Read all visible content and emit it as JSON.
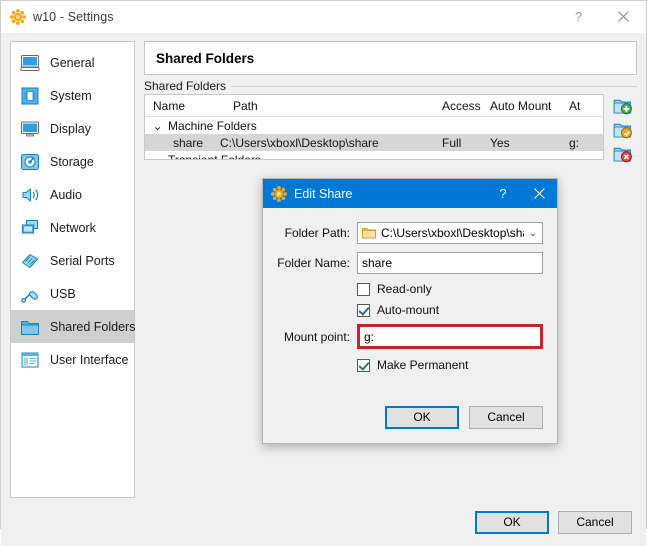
{
  "window": {
    "title": "w10 - Settings",
    "icon": "virtualbox-icon",
    "help_label": "?",
    "close_label": "✕"
  },
  "sidebar": {
    "items": [
      {
        "label": "General",
        "icon": "general-icon",
        "selected": false
      },
      {
        "label": "System",
        "icon": "system-icon",
        "selected": false
      },
      {
        "label": "Display",
        "icon": "display-icon",
        "selected": false
      },
      {
        "label": "Storage",
        "icon": "storage-icon",
        "selected": false
      },
      {
        "label": "Audio",
        "icon": "audio-icon",
        "selected": false
      },
      {
        "label": "Network",
        "icon": "network-icon",
        "selected": false
      },
      {
        "label": "Serial Ports",
        "icon": "serial-ports-icon",
        "selected": false
      },
      {
        "label": "USB",
        "icon": "usb-icon",
        "selected": false
      },
      {
        "label": "Shared Folders",
        "icon": "shared-folders-icon",
        "selected": true
      },
      {
        "label": "User Interface",
        "icon": "user-interface-icon",
        "selected": false
      }
    ]
  },
  "pane": {
    "title": "Shared Folders",
    "group_legend": "Shared Folders"
  },
  "table": {
    "columns": [
      "Name",
      "Path",
      "Access",
      "Auto Mount",
      "At"
    ],
    "groups": [
      {
        "label": "Machine Folders",
        "expanded": true,
        "chevron": "⌄",
        "rows": [
          {
            "name": "share",
            "path": "C:\\Users\\xboxl\\Desktop\\share",
            "access": "Full",
            "auto_mount": "Yes",
            "at": "g:",
            "selected": true
          }
        ]
      },
      {
        "label": "Transient Folders",
        "expanded": false,
        "chevron": "",
        "rows": []
      }
    ]
  },
  "table_tools": [
    {
      "name": "add-shared-folder-icon",
      "title": "Add Shared Folder"
    },
    {
      "name": "edit-shared-folder-icon",
      "title": "Edit Shared Folder"
    },
    {
      "name": "remove-shared-folder-icon",
      "title": "Remove Shared Folder"
    }
  ],
  "footer": {
    "ok_label": "OK",
    "cancel_label": "Cancel"
  },
  "dialog": {
    "title": "Edit Share",
    "icon": "virtualbox-icon",
    "help_label": "?",
    "close_label": "✕",
    "folder_path": {
      "label": "Folder Path:",
      "value": "C:\\Users\\xboxl\\Desktop\\share",
      "icon": "folder-icon",
      "caret": "⌄"
    },
    "folder_name": {
      "label": "Folder Name:",
      "value": "share"
    },
    "read_only": {
      "label": "Read-only",
      "checked": false
    },
    "auto_mount": {
      "label": "Auto-mount",
      "checked": true
    },
    "mount_point": {
      "label": "Mount point:",
      "value": "g:",
      "highlighted": true,
      "highlight_color": "#cc2229"
    },
    "make_permanent": {
      "label": "Make Permanent",
      "checked": true
    },
    "ok_label": "OK",
    "cancel_label": "Cancel"
  },
  "colors": {
    "dialog_titlebar": "#0078d7",
    "accent": "#0078d7",
    "selection_row": "#d6d6d6",
    "sidebar_selected": "#cfcfcf",
    "highlight_red": "#cc2229"
  }
}
